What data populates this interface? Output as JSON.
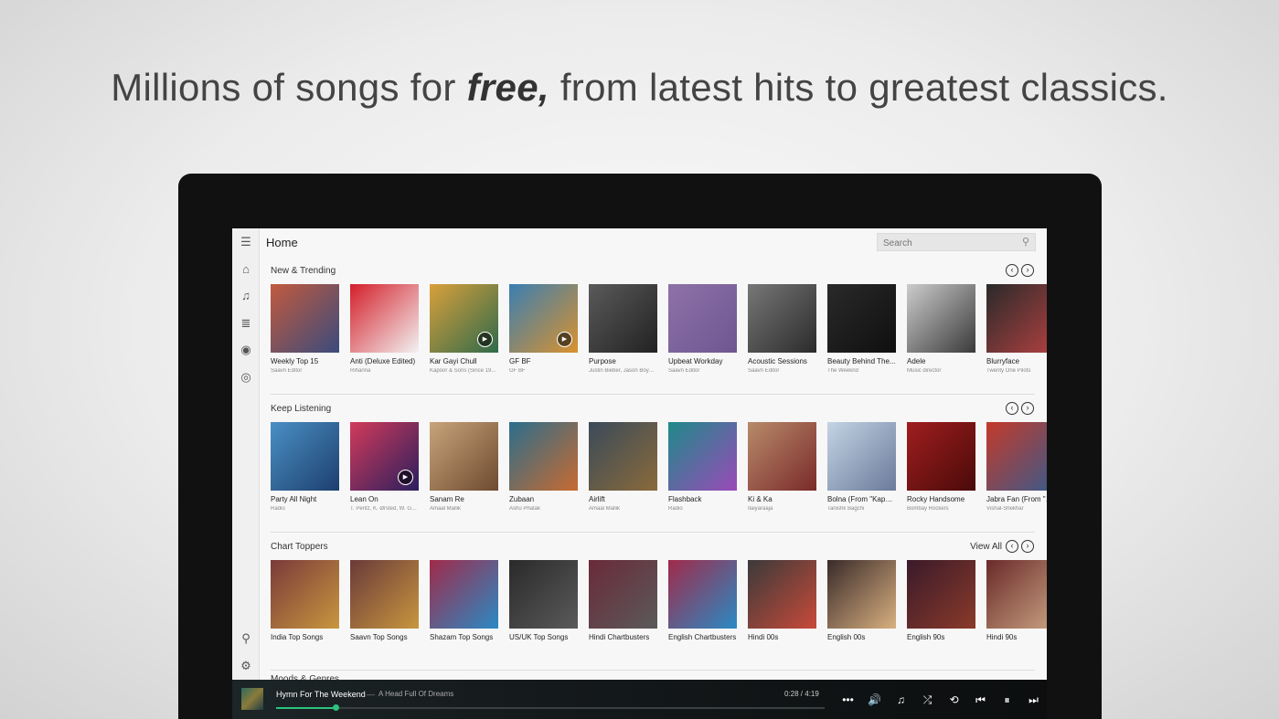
{
  "headline": {
    "before": "Millions of songs for ",
    "emphasis": "free,",
    "after": " from latest hits to greatest classics."
  },
  "app": {
    "title": "Home",
    "search_placeholder": "Search",
    "rail_icons": [
      "hamburger-menu-icon",
      "home-icon",
      "music-note-icon",
      "playlist-icon",
      "radio-icon",
      "compass-icon",
      "location-pin-icon",
      "gear-icon"
    ]
  },
  "sections": [
    {
      "title": "New & Trending",
      "view_all": "",
      "items": [
        {
          "name": "Weekly Top 15",
          "sub": "Saavn Editor",
          "color1": "#c25a3e",
          "color2": "#3a4b7c",
          "play": false
        },
        {
          "name": "Anti (Deluxe Edited)",
          "sub": "Rihanna",
          "color1": "#d41f2a",
          "color2": "#f2f2f2",
          "play": false
        },
        {
          "name": "Kar Gayi Chull",
          "sub": "Kapoor & Sons (Since 19...",
          "color1": "#d9a03c",
          "color2": "#2f6a4a",
          "play": true
        },
        {
          "name": "GF BF",
          "sub": "GF BF",
          "color1": "#3a7eb2",
          "color2": "#d9922e",
          "play": true
        },
        {
          "name": "Purpose",
          "sub": "Justin Bieber, Jason Boyd,...",
          "color1": "#5a5a5a",
          "color2": "#222222",
          "play": false
        },
        {
          "name": "Upbeat Workday",
          "sub": "Saavn Editor",
          "color1": "#8e72a8",
          "color2": "#6e5690",
          "play": false
        },
        {
          "name": "Acoustic Sessions",
          "sub": "Saavn Editor",
          "color1": "#777777",
          "color2": "#2b2b2b",
          "play": false
        },
        {
          "name": "Beauty Behind The...",
          "sub": "The Weeknd",
          "color1": "#2a2a2a",
          "color2": "#0f0f0f",
          "play": false
        },
        {
          "name": "Adele",
          "sub": "Music director",
          "color1": "#cccccc",
          "color2": "#3a3a3a",
          "play": false
        },
        {
          "name": "Blurryface",
          "sub": "Twenty One Pilots",
          "color1": "#2a2a2a",
          "color2": "#b04040",
          "play": false
        }
      ]
    },
    {
      "title": "Keep Listening",
      "view_all": "",
      "items": [
        {
          "name": "Party All Night",
          "sub": "Radio",
          "color1": "#4a8fc4",
          "color2": "#1d3f6e",
          "play": false
        },
        {
          "name": "Lean On",
          "sub": "T. Pentz, K. Ørsted, W. Gri...",
          "color1": "#d23a5a",
          "color2": "#2a1f5e",
          "play": true
        },
        {
          "name": "Sanam Re",
          "sub": "Amaal Mallik",
          "color1": "#c8a47a",
          "color2": "#6e4a30",
          "play": false
        },
        {
          "name": "Zubaan",
          "sub": "Ashu Phatak",
          "color1": "#2b6e8c",
          "color2": "#c86a30",
          "play": false
        },
        {
          "name": "Airlift",
          "sub": "Amaal Mallik",
          "color1": "#3a4a5a",
          "color2": "#8a6a3a",
          "play": false
        },
        {
          "name": "Flashback",
          "sub": "Radio",
          "color1": "#1e8a8a",
          "color2": "#9a4ab8",
          "play": false
        },
        {
          "name": "Ki & Ka",
          "sub": "Ilaiyaraaja",
          "color1": "#b88a6a",
          "color2": "#7a2a2a",
          "play": false
        },
        {
          "name": "Bolna (From \"Kapoor...",
          "sub": "Tanishk Bagchi",
          "color1": "#c4d4e4",
          "color2": "#6a7a9a",
          "play": false
        },
        {
          "name": "Rocky Handsome",
          "sub": "Bombay Rockers",
          "color1": "#a01e1e",
          "color2": "#4a0a0a",
          "play": false
        },
        {
          "name": "Jabra Fan (From \"Fan\")",
          "sub": "Vishal-Shekhar",
          "color1": "#c43a2a",
          "color2": "#3a5a8a",
          "play": false
        }
      ]
    },
    {
      "title": "Chart Toppers",
      "view_all": "View All",
      "items": [
        {
          "name": "India Top Songs",
          "sub": "",
          "color1": "#7a3a3a",
          "color2": "#c8963e",
          "play": false
        },
        {
          "name": "Saavn Top Songs",
          "sub": "",
          "color1": "#6a3a3a",
          "color2": "#c8963e",
          "play": false
        },
        {
          "name": "Shazam Top Songs",
          "sub": "",
          "color1": "#a02a4a",
          "color2": "#2a8ac4",
          "play": false
        },
        {
          "name": "US/UK Top Songs",
          "sub": "",
          "color1": "#2a2a2a",
          "color2": "#5a5a5a",
          "play": false
        },
        {
          "name": "Hindi Chartbusters",
          "sub": "",
          "color1": "#6a2a3a",
          "color2": "#5a5a5a",
          "play": false
        },
        {
          "name": "English Chartbusters",
          "sub": "",
          "color1": "#a02a4a",
          "color2": "#2a8ac4",
          "play": false
        },
        {
          "name": "Hindi 00s",
          "sub": "",
          "color1": "#3a3a3a",
          "color2": "#c84a3a",
          "play": false
        },
        {
          "name": "English 00s",
          "sub": "",
          "color1": "#3a2a2a",
          "color2": "#d8b080",
          "play": false
        },
        {
          "name": "English 90s",
          "sub": "",
          "color1": "#3a1a2a",
          "color2": "#8a3a2a",
          "play": false
        },
        {
          "name": "Hindi 90s",
          "sub": "",
          "color1": "#6a2a2a",
          "color2": "#c8a080",
          "play": false
        }
      ]
    }
  ],
  "peek_section_title": "Moods & Genres",
  "player": {
    "title": "Hymn For The Weekend",
    "separator": "—",
    "album": "A Head Full Of Dreams",
    "time": "0:28 / 4:19",
    "progress": 0.108,
    "accent": "#2ec27e",
    "controls": [
      "more-icon",
      "volume-icon",
      "queue-icon",
      "shuffle-icon",
      "repeat-icon",
      "previous-icon",
      "pause-icon",
      "next-icon"
    ]
  }
}
